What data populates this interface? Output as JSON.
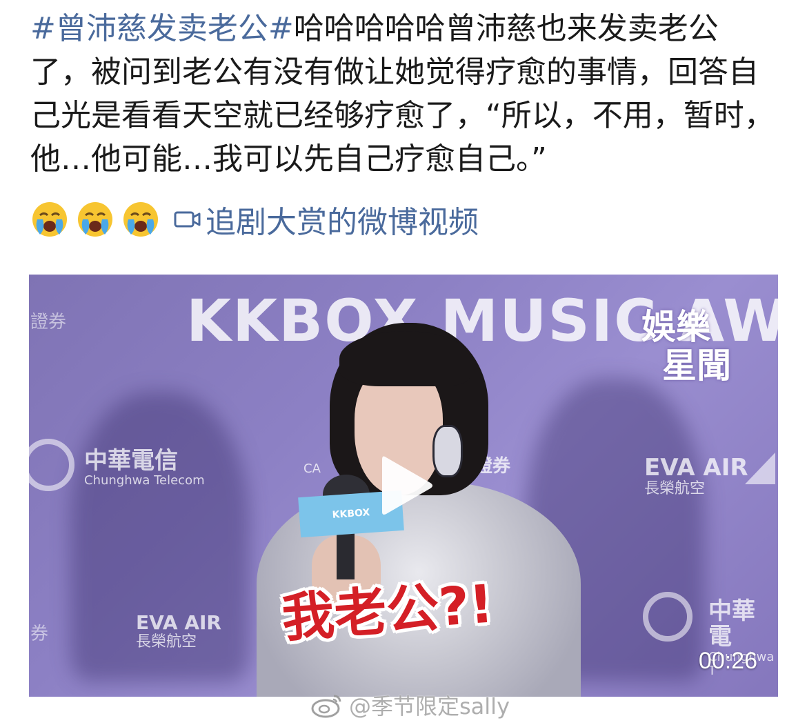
{
  "post": {
    "hashtag": "#曾沛慈发卖老公#",
    "body": "哈哈哈哈哈曾沛慈也来发卖老公了，被问到老公有没有做让她觉得疗愈的事情，回答自己光是看看天空就已经够疗愈了，“所以，不用，暂时，他…他可能…我可以先自己疗愈自己。”",
    "emojis": [
      "crying-face",
      "crying-face",
      "crying-face"
    ],
    "video_link": {
      "icon": "video-camera-icon",
      "label": "追剧大赏的微博视频"
    }
  },
  "video": {
    "backdrop_title": "KKBOX MUSIC AWAR",
    "channel_logo_line1": "娛樂",
    "channel_logo_line2": "星聞",
    "sponsors": {
      "chunghwa_cn": "中華電信",
      "chunghwa_en": "Chunghwa Telecom",
      "eva_en": "EVA AIR",
      "eva_cn": "長榮航空",
      "eva2_en": "EVA AIR",
      "eva2_cn": "長榮航空",
      "chunghwa2_cn": "中華電",
      "chunghwa2_en": "Chunghwa T",
      "center_text": "鼎證券",
      "side_left_1": "證券",
      "side_left_2": "券",
      "ca_text": "CA"
    },
    "mic_flag": "KKBOX",
    "caption": "我老公?!",
    "duration": "00:26",
    "play_icon": "play-icon"
  },
  "watermark": {
    "icon": "weibo-icon",
    "text": "@季节限定sally"
  },
  "colors": {
    "link": "#4a6a9c",
    "text": "#1a1a1a",
    "caption": "#d41f26",
    "emoji_face": "#f7c531",
    "emoji_tears": "#4aa8e8"
  }
}
